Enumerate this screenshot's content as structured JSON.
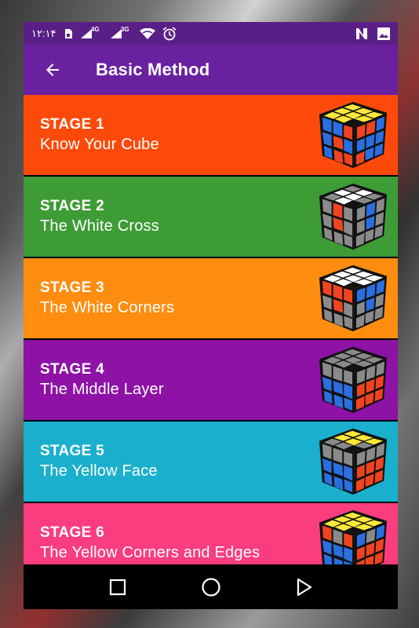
{
  "status_bar": {
    "time": "۱۲:۱۴",
    "network_1": "4G",
    "network_2": "3G",
    "icons": [
      "sim-icon",
      "signal-icon",
      "signal-icon",
      "wifi-icon",
      "alarm-icon",
      "n-app-icon",
      "gallery-icon"
    ]
  },
  "appbar": {
    "title": "Basic Method"
  },
  "stages": [
    {
      "stage": "STAGE 1",
      "name": "Know Your Cube",
      "color": "#fd4a0a"
    },
    {
      "stage": "STAGE 2",
      "name": "The White Cross",
      "color": "#3e9c36"
    },
    {
      "stage": "STAGE 3",
      "name": "The White Corners",
      "color": "#fe8d10"
    },
    {
      "stage": "STAGE 4",
      "name": "The Middle Layer",
      "color": "#8d12a5"
    },
    {
      "stage": "STAGE 5",
      "name": "The Yellow Face",
      "color": "#1aafcc"
    },
    {
      "stage": "STAGE 6",
      "name": "The Yellow Corners and Edges",
      "color": "#f93d7f"
    }
  ],
  "navbar": {
    "icons": [
      "recents-square-icon",
      "home-circle-icon",
      "back-triangle-icon"
    ]
  }
}
